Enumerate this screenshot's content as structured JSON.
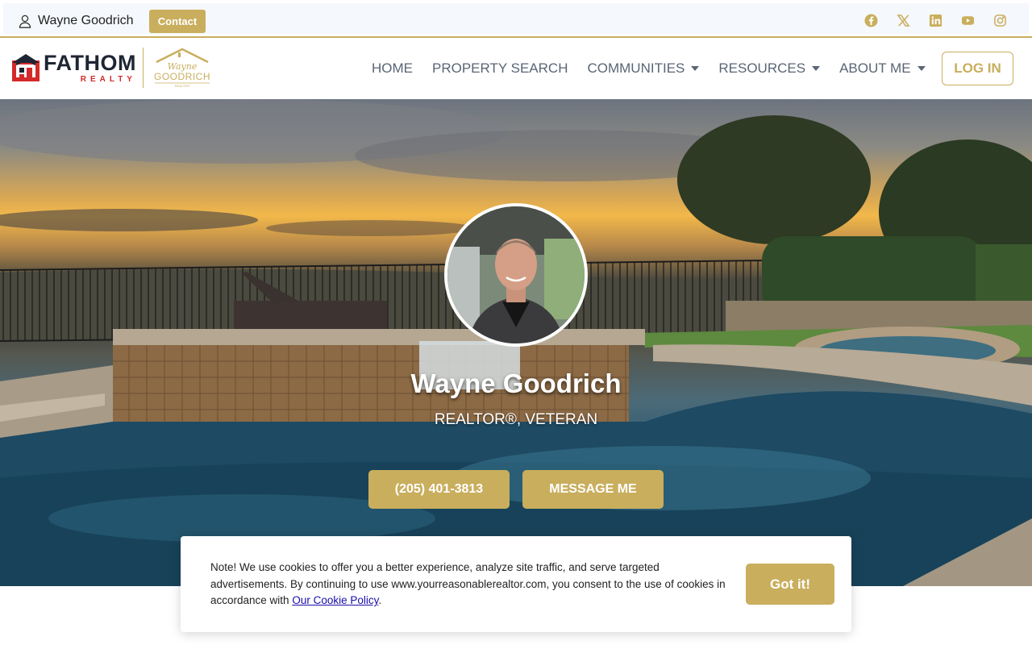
{
  "topbar": {
    "agent_name": "Wayne Goodrich",
    "contact_label": "Contact",
    "socials": [
      "facebook-icon",
      "x-icon",
      "linkedin-icon",
      "youtube-icon",
      "instagram-icon"
    ]
  },
  "brand": {
    "fathom_word": "FATHOM",
    "fathom_sub": "REALTY",
    "wg_script": "Wayne",
    "wg_block": "GOODRICH",
    "wg_tag": "REALTOR"
  },
  "nav": {
    "items": [
      {
        "label": "HOME",
        "dropdown": false
      },
      {
        "label": "PROPERTY SEARCH",
        "dropdown": false
      },
      {
        "label": "COMMUNITIES",
        "dropdown": true
      },
      {
        "label": "RESOURCES",
        "dropdown": true
      },
      {
        "label": "ABOUT ME",
        "dropdown": true
      }
    ],
    "login_label": "LOG IN"
  },
  "hero": {
    "name": "Wayne Goodrich",
    "title": "REALTOR®, VETERAN",
    "phone_label": "(205) 401-3813",
    "message_label": "MESSAGE ME"
  },
  "cookie": {
    "text": "Note! We use cookies to offer you a better experience, analyze site traffic, and serve targeted advertisements. By continuing to use www.yourreasonablerealtor.com, you consent to the use of cookies in accordance with ",
    "link_label": "Our Cookie Policy",
    "trailing": ".",
    "button_label": "Got it!"
  },
  "colors": {
    "accent": "#c9ae5d",
    "nav_text": "#5a6575",
    "brand_red": "#d42a2a",
    "brand_dark": "#1e2533"
  }
}
